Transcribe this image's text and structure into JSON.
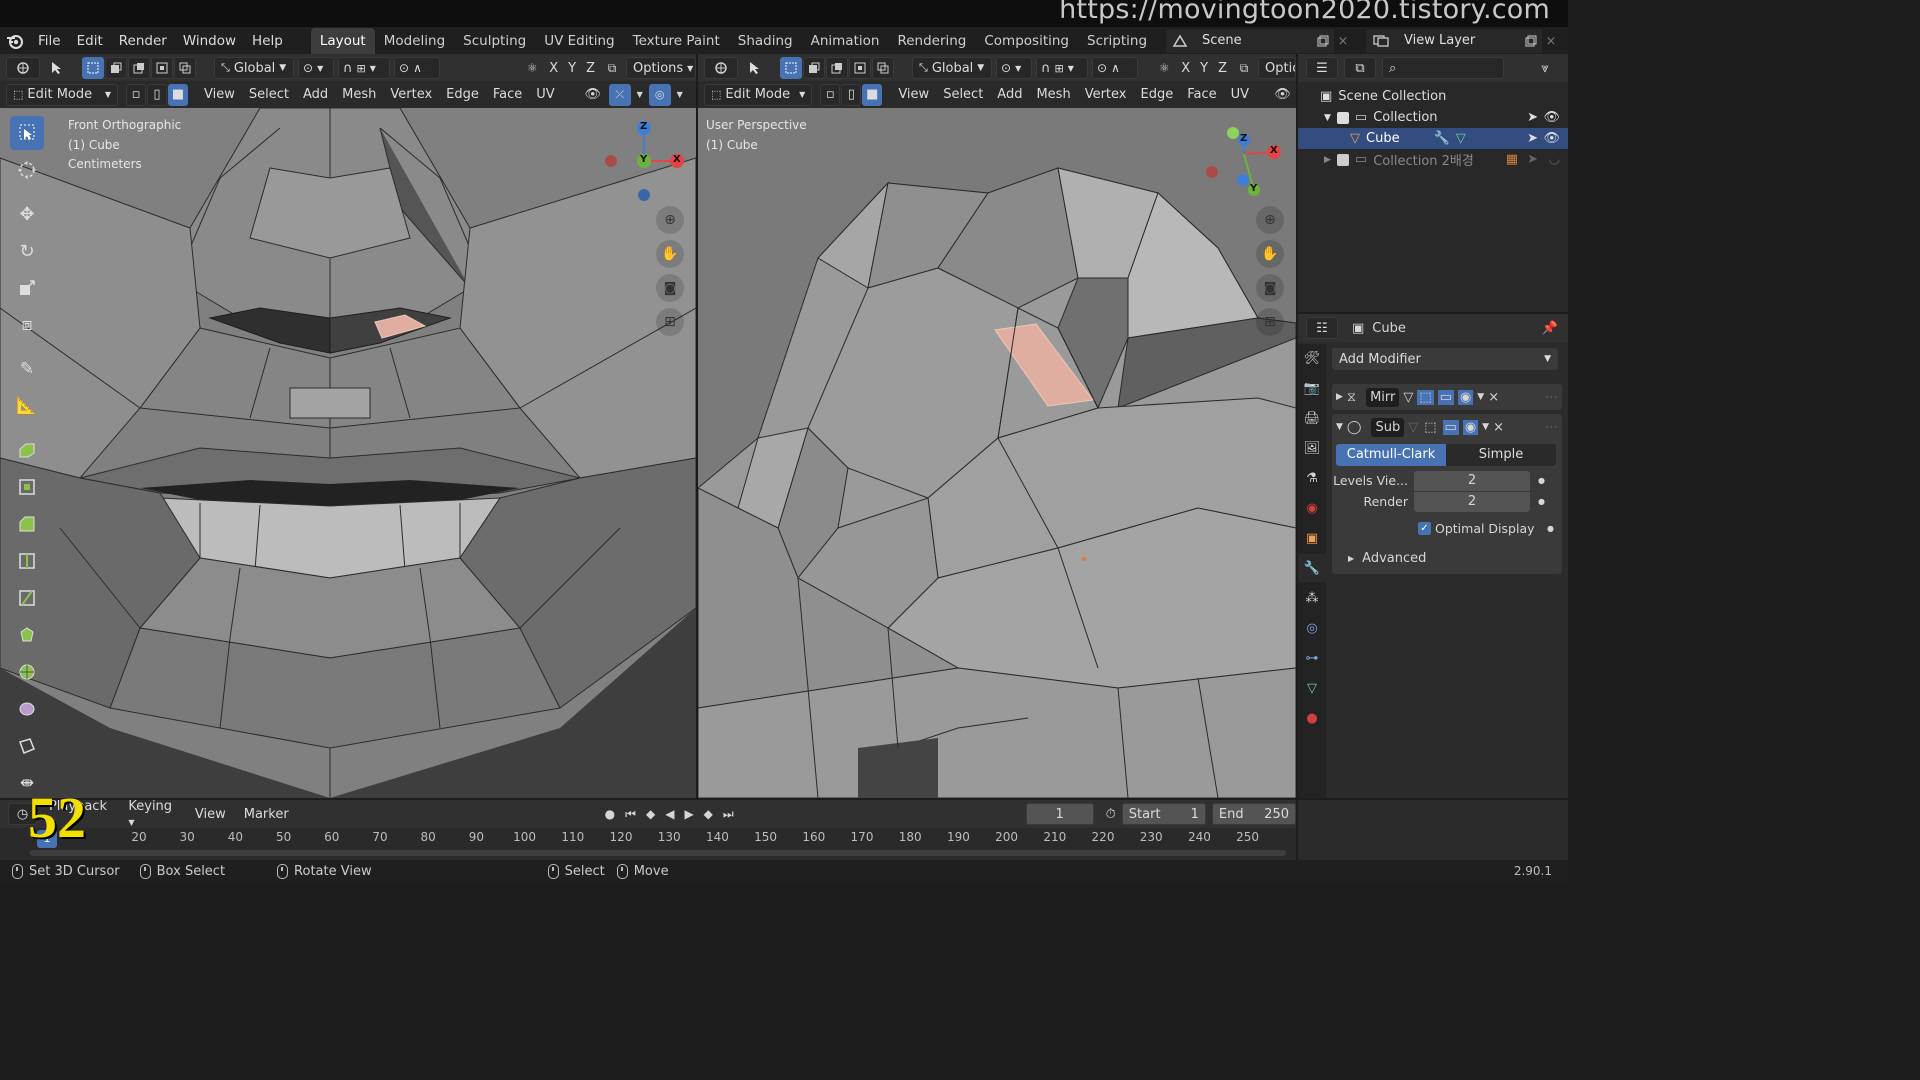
{
  "watermark": "https://movingtoon2020.tistory.com",
  "menu": [
    "File",
    "Edit",
    "Render",
    "Window",
    "Help"
  ],
  "workspaces": [
    "Layout",
    "Modeling",
    "Sculpting",
    "UV Editing",
    "Texture Paint",
    "Shading",
    "Animation",
    "Rendering",
    "Compositing",
    "Scripting"
  ],
  "active_workspace": "Layout",
  "scene": "Scene",
  "view_layer": "View Layer",
  "left_view": {
    "orientation": "Global",
    "options": "Options",
    "axes": [
      "X",
      "Y",
      "Z"
    ],
    "mode": "Edit Mode",
    "menus": [
      "View",
      "Select",
      "Add",
      "Mesh",
      "Vertex",
      "Edge",
      "Face",
      "UV"
    ],
    "overlay": [
      "Front Orthographic",
      "(1) Cube",
      "Centimeters"
    ],
    "gizmo": {
      "z": "Z",
      "y": "Y",
      "x": "X"
    }
  },
  "right_view": {
    "orientation": "Global",
    "options": "Optio",
    "axes": [
      "X",
      "Y",
      "Z"
    ],
    "mode": "Edit Mode",
    "menus": [
      "View",
      "Select",
      "Add",
      "Mesh",
      "Vertex",
      "Edge",
      "Face",
      "UV"
    ],
    "overlay": [
      "User Perspective",
      "(1) Cube"
    ],
    "gizmo": {
      "z": "Z",
      "y": "Y",
      "x": "X"
    }
  },
  "outliner": {
    "rows": [
      {
        "label": "Scene Collection"
      },
      {
        "label": "Collection"
      },
      {
        "label": "Cube"
      },
      {
        "label": "Collection 2배경"
      }
    ]
  },
  "properties": {
    "object": "Cube",
    "add_modifier": "Add Modifier",
    "modifiers": [
      {
        "name": "Mirr"
      },
      {
        "name": "Sub"
      }
    ],
    "subdiv_types": [
      "Catmull-Clark",
      "Simple"
    ],
    "levels_label": "Levels Vie...",
    "levels_value": "2",
    "render_label": "Render",
    "render_value": "2",
    "optimal_display": "Optimal Display",
    "advanced": "Advanced"
  },
  "timeline": {
    "menus": [
      "Playback",
      "Keying",
      "View",
      "Marker"
    ],
    "current_frame": "1",
    "start_label": "Start",
    "start": "1",
    "end_label": "End",
    "end": "250",
    "ticks": [
      "20",
      "30",
      "40",
      "50",
      "60",
      "70",
      "80",
      "90",
      "100",
      "110",
      "120",
      "130",
      "140",
      "150",
      "160",
      "170",
      "180",
      "190",
      "200",
      "210",
      "220",
      "230",
      "240",
      "250"
    ],
    "frame_marker": "1",
    "overlay_number": "52"
  },
  "status": {
    "items": [
      "Set 3D Cursor",
      "Box Select",
      "Rotate View",
      "Select",
      "Move"
    ],
    "version": "2.90.1"
  },
  "colors": {
    "accent": "#4772b3",
    "selected_face": "#e0aea0",
    "header": "#303030",
    "panel": "#2b2b2b"
  }
}
